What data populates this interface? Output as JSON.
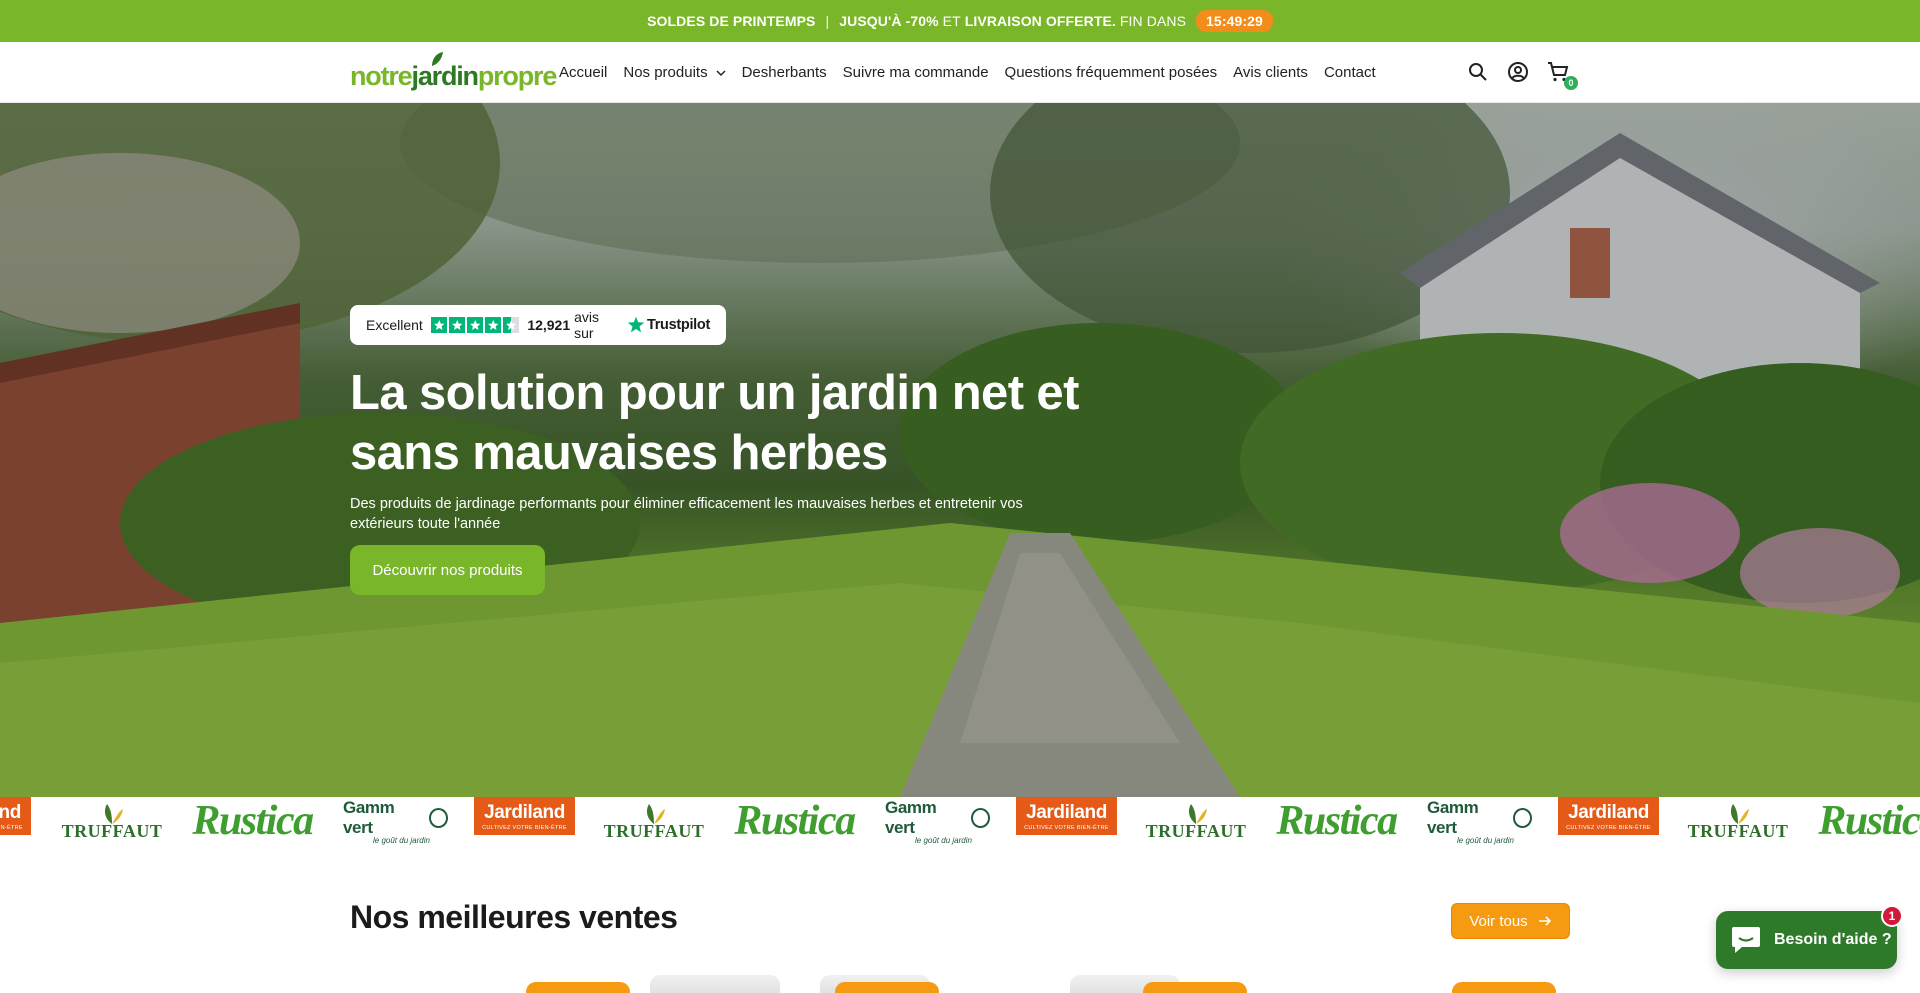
{
  "announcement": {
    "sale": "SOLDES DE PRINTEMPS",
    "separator": "|",
    "offer_prefix": "JUSQU'À -70%",
    "offer_and": "ET",
    "offer_shipping": "LIVRAISON OFFERTE.",
    "ends_in": "FIN DANS",
    "timer": "15:49:29"
  },
  "header": {
    "logo": {
      "part1": "notre",
      "part2": "jardin",
      "part3": "propre"
    },
    "nav": [
      {
        "label": "Accueil"
      },
      {
        "label": "Nos produits",
        "has_dropdown": true
      },
      {
        "label": "Desherbants"
      },
      {
        "label": "Suivre ma commande"
      },
      {
        "label": "Questions fréquemment posées"
      },
      {
        "label": "Avis clients"
      },
      {
        "label": "Contact"
      }
    ],
    "icons": [
      "search-icon",
      "account-icon",
      "cart-icon"
    ],
    "cart_count": "0"
  },
  "hero": {
    "trustpilot": {
      "rating_word": "Excellent",
      "stars": 4.5,
      "review_count": "12,921",
      "reviews_on": "avis sur",
      "brand": "Trustpilot"
    },
    "title": "La solution pour un jardin net et sans mauvaises herbes",
    "subtitle": "Des produits de jardinage performants pour éliminer efficacement les mauvaises herbes et entretenir vos extérieurs toute l'année",
    "cta": "Découvrir nos produits"
  },
  "brands": {
    "truffaut": "TRUFFAUT",
    "rustica": "Rustica",
    "gamm_vert": "Gamm vert",
    "gamm_vert_tagline": "le goût du jardin",
    "jardiland": "Jardiland",
    "jardiland_tagline": "CULTIVEZ VOTRE BIEN-ÊTRE"
  },
  "best_sellers": {
    "title": "Nos meilleures ventes",
    "view_all": "Voir tous"
  },
  "chat": {
    "label": "Besoin d'aide ?",
    "badge": "1"
  },
  "colors": {
    "brand_green": "#7ab62a",
    "dark_green": "#2d7a23",
    "orange": "#f59a11",
    "timer_orange": "#f28c1b",
    "trustpilot_green": "#00b67a",
    "chat_green": "#2f7a2a"
  }
}
